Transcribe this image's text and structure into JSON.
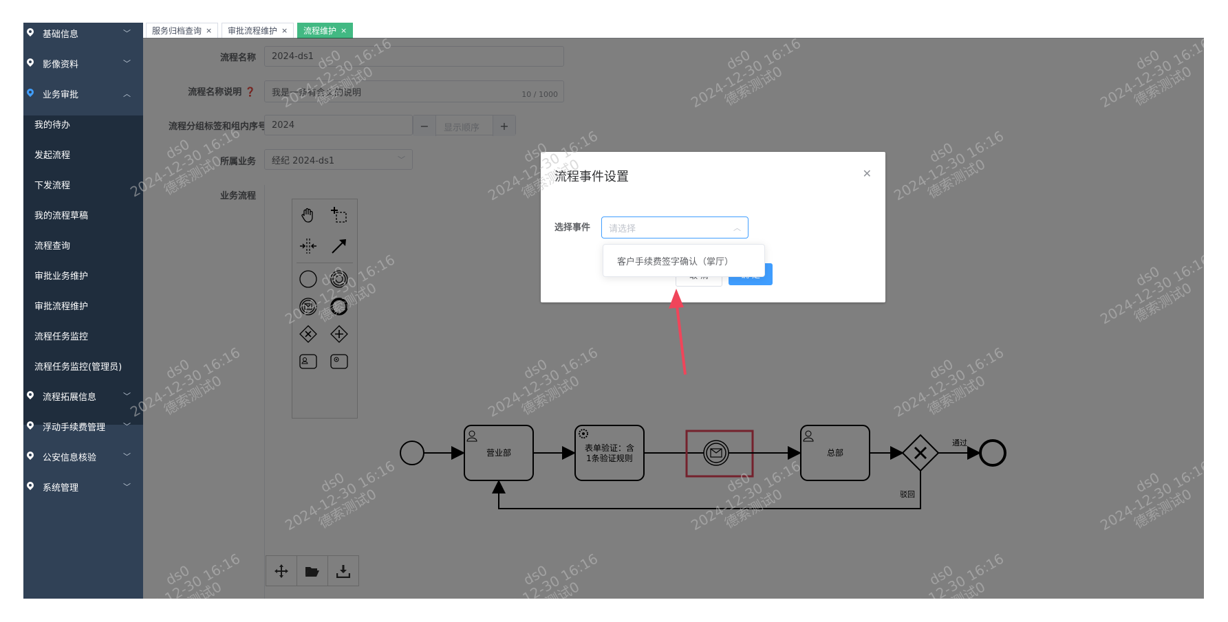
{
  "sidebar": {
    "menus": [
      {
        "label": "基础信息",
        "expanded": false
      },
      {
        "label": "影像资料",
        "expanded": false
      },
      {
        "label": "业务审批",
        "expanded": true
      },
      {
        "label": "流程拓展信息",
        "expanded": false
      },
      {
        "label": "浮动手续费管理",
        "expanded": false
      },
      {
        "label": "公安信息核验",
        "expanded": false
      },
      {
        "label": "系统管理",
        "expanded": false
      }
    ],
    "submenu": [
      "我的待办",
      "发起流程",
      "下发流程",
      "我的流程草稿",
      "流程查询",
      "审批业务维护",
      "审批流程维护",
      "流程任务监控",
      "流程任务监控(管理员)"
    ]
  },
  "tabs": [
    {
      "label": "服务归档查询",
      "active": false
    },
    {
      "label": "审批流程维护",
      "active": false
    },
    {
      "label": "流程维护",
      "active": true
    }
  ],
  "form": {
    "name_label": "流程名称",
    "name_value": "2024-ds1",
    "desc_label": "流程名称说明",
    "desc_value": "我是一条有含义的说明",
    "desc_counter": "10 / 1000",
    "group_label": "流程分组标签和组内序号",
    "group_value": "2024",
    "order_placeholder": "显示顺序",
    "business_label": "所属业务",
    "business_value": "经纪 2024-ds1",
    "flow_label": "业务流程"
  },
  "diagram": {
    "task1": "营业部",
    "task2_line1": "表单验证：含",
    "task2_line2": "1条验证规则",
    "task3": "总部",
    "pass_label": "通过",
    "reject_label": "驳回"
  },
  "dialog": {
    "title": "流程事件设置",
    "select_label": "选择事件",
    "select_placeholder": "请选择",
    "option": "客户手续费签字确认（掌厅）",
    "cancel": "取 消",
    "ok": "确 定"
  },
  "watermark": {
    "line1": "ds0",
    "line2": "2024-12-30 16:16",
    "line3": "德索测试0"
  },
  "colors": {
    "sidebar_bg": "#304156",
    "sidebar_sub_bg": "#1f2d3d",
    "active_tab": "#42b983",
    "primary": "#409EFF",
    "highlight": "#e8455a"
  }
}
